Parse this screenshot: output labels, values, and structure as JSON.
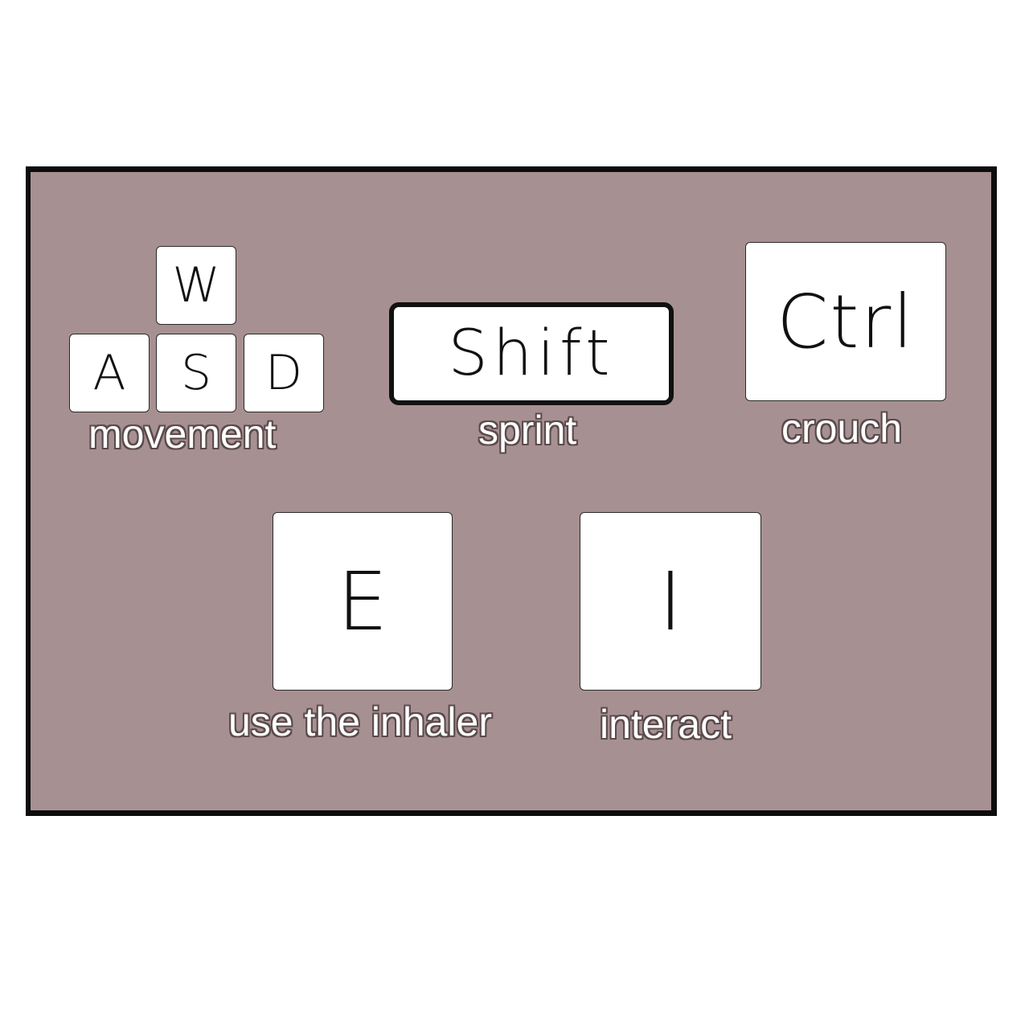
{
  "colors": {
    "panel_background": "#a79091",
    "panel_border": "#0d0d0d",
    "key_fill": "#ffffff",
    "label_text": "#ffffff"
  },
  "controls": {
    "movement": {
      "keys": [
        "W",
        "A",
        "S",
        "D"
      ],
      "label": "movement"
    },
    "sprint": {
      "key": "Shift",
      "label": "sprint"
    },
    "crouch": {
      "key": "Ctrl",
      "label": "crouch"
    },
    "inhaler": {
      "key": "E",
      "label": "use the inhaler"
    },
    "interact": {
      "key": "I",
      "label": "interact"
    }
  }
}
